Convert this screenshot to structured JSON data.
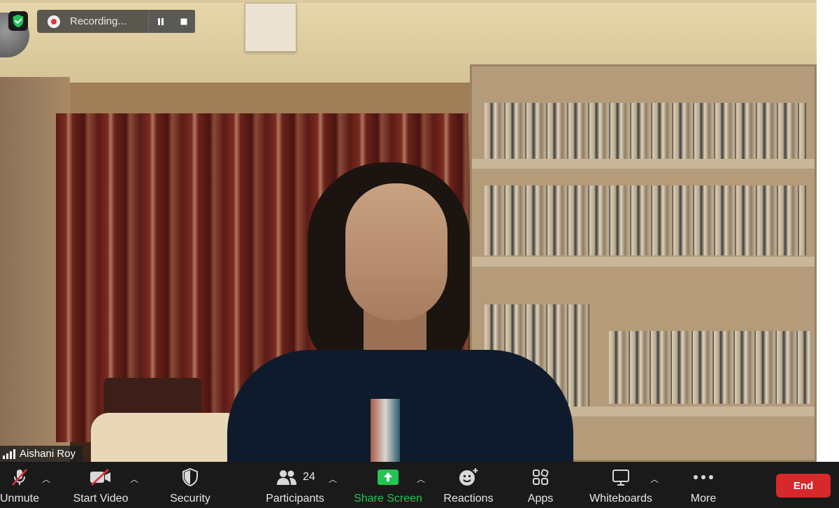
{
  "recording": {
    "label": "Recording..."
  },
  "participant": {
    "name": "Aishani Roy"
  },
  "toolbar": {
    "unmute_label": "Unmute",
    "start_video_label": "Start Video",
    "security_label": "Security",
    "participants_label": "Participants",
    "participants_count": "24",
    "share_screen_label": "Share Screen",
    "reactions_label": "Reactions",
    "apps_label": "Apps",
    "whiteboards_label": "Whiteboards",
    "more_label": "More",
    "end_label": "End"
  },
  "colors": {
    "share_green": "#23c552",
    "end_red": "#d7282b",
    "toolbar_bg": "#1a1a1a",
    "shield_green": "#22c35a"
  }
}
